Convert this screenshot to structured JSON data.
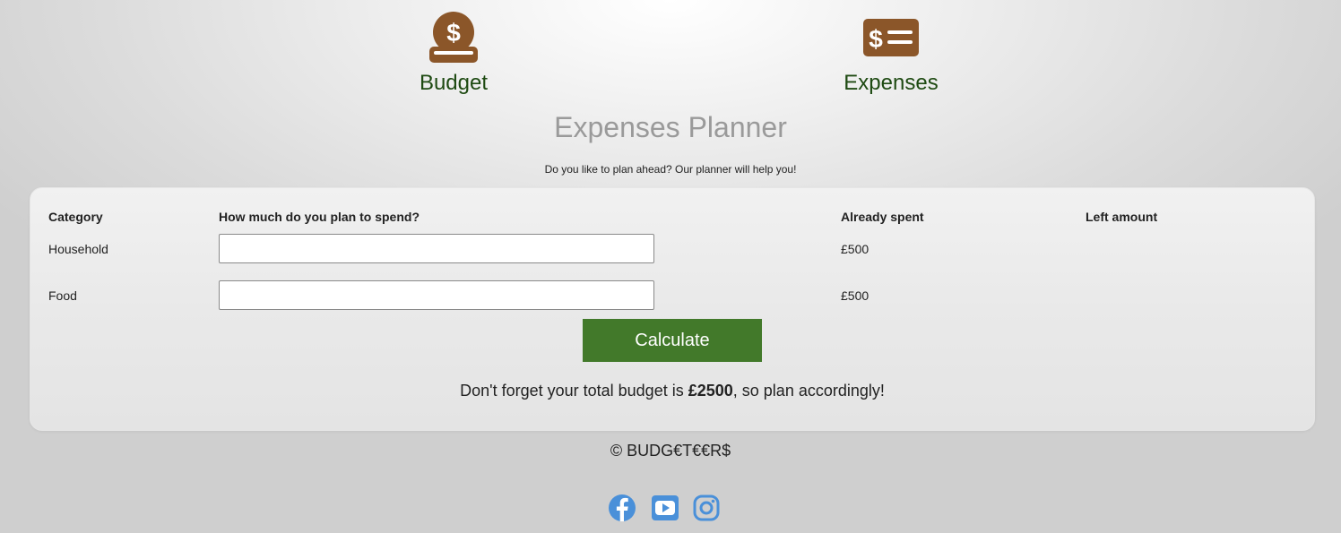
{
  "nav": {
    "budget_label": "Budget",
    "expenses_label": "Expenses",
    "budget_icon": "dollar-coin-icon",
    "expenses_icon": "money-list-icon"
  },
  "header": {
    "title": "Expenses Planner",
    "subtitle": "Do you like to plan ahead? Our planner will help you!"
  },
  "table": {
    "columns": [
      "Category",
      "How much do you plan to spend?",
      "Already spent",
      "Left amount"
    ],
    "rows": [
      {
        "category": "Household",
        "plan_value": "",
        "spent": "£500",
        "left": ""
      },
      {
        "category": "Food",
        "plan_value": "",
        "spent": "£500",
        "left": ""
      }
    ]
  },
  "calculate_label": "Calculate",
  "reminder": {
    "prefix": "Don't forget your total budget is ",
    "amount": "£2500",
    "suffix": ", so plan accordingly!"
  },
  "footer": {
    "copyright": "© BUDG€T€€R$"
  },
  "social": [
    "facebook-icon",
    "youtube-icon",
    "instagram-icon"
  ],
  "colors": {
    "brand_brown": "#8b5629",
    "nav_text": "#1e4a12",
    "button_green": "#42792a",
    "social_blue": "#4a90d9",
    "title_gray": "#9a9a9a"
  }
}
